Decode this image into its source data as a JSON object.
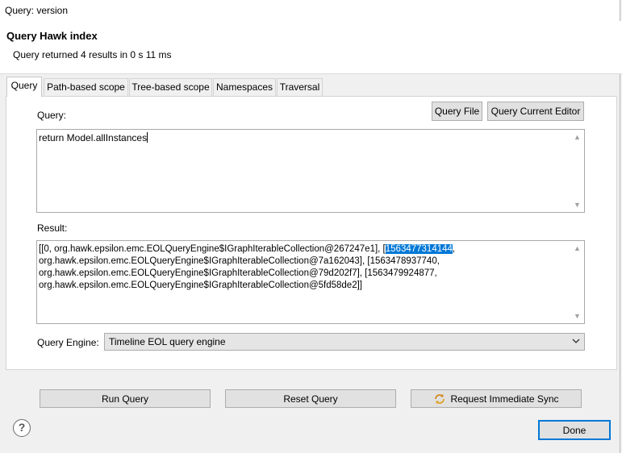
{
  "window": {
    "title": "Query: version"
  },
  "header": {
    "title": "Query Hawk index",
    "message": "Query returned 4 results in 0 s 11 ms"
  },
  "tabs": [
    {
      "label": "Query"
    },
    {
      "label": "Path-based scope"
    },
    {
      "label": "Tree-based scope"
    },
    {
      "label": "Namespaces"
    },
    {
      "label": "Traversal"
    }
  ],
  "query": {
    "label": "Query:",
    "value": "return Model.allInstances",
    "query_file_button": "Query File",
    "query_editor_button": "Query Current Editor"
  },
  "result": {
    "label": "Result:",
    "line1_prefix": "[[0, org.hawk.epsilon.emc.EOLQueryEngine$IGraphIterableCollection@267247e1], [",
    "line1_selected": "1563477314144",
    "line1_suffix": ",",
    "line2": "org.hawk.epsilon.emc.EOLQueryEngine$IGraphIterableCollection@7a162043], [1563478937740,",
    "line3": "org.hawk.epsilon.emc.EOLQueryEngine$IGraphIterableCollection@79d202f7], [1563479924877,",
    "line4": "org.hawk.epsilon.emc.EOLQueryEngine$IGraphIterableCollection@5fd58de2]]"
  },
  "engine": {
    "label": "Query Engine:",
    "selected": "Timeline EOL query engine"
  },
  "buttons": {
    "run": "Run Query",
    "reset": "Reset Query",
    "sync": "Request Immediate Sync",
    "done": "Done"
  },
  "icons": {
    "help": "help-icon",
    "sync": "sync-icon"
  },
  "colors": {
    "selection": "#0078d7",
    "default_button_border": "#0078d7"
  }
}
